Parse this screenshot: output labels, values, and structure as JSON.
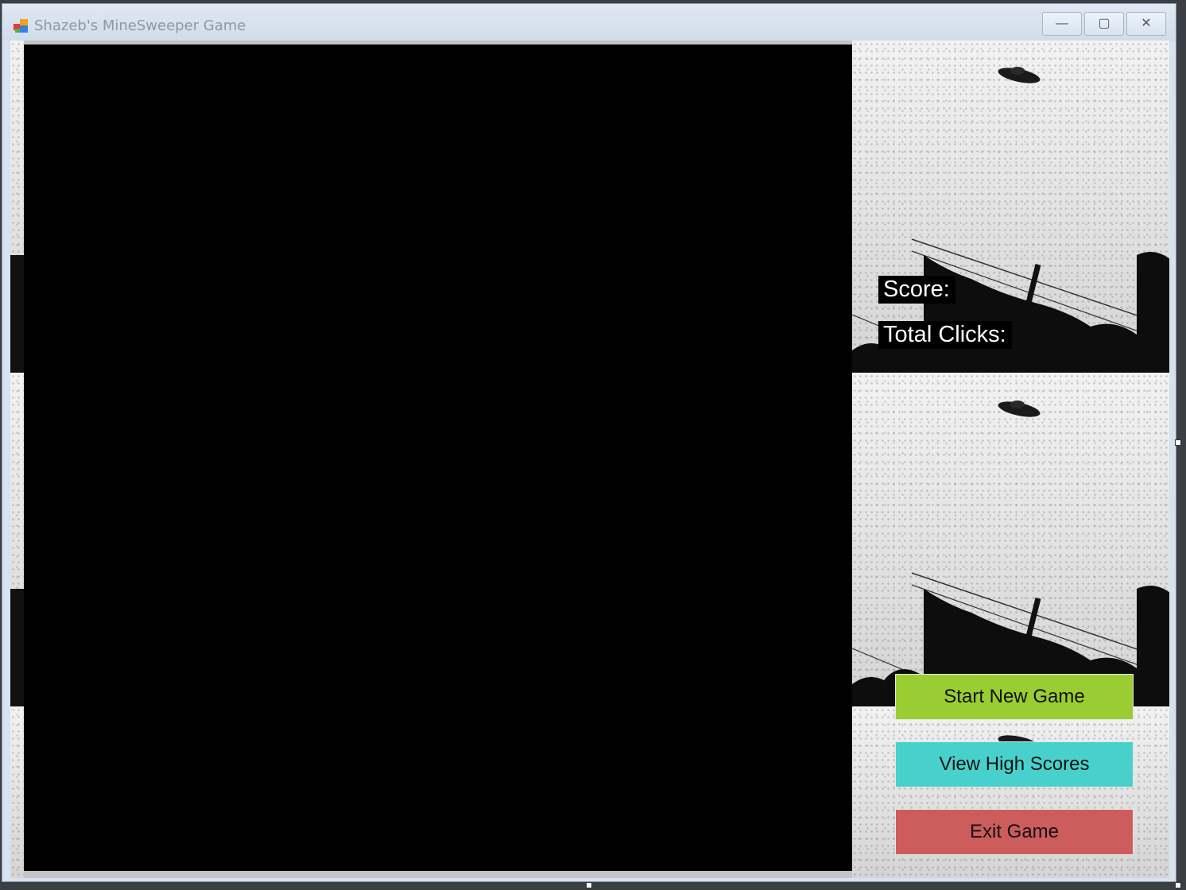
{
  "window": {
    "title": "Shazeb's MineSweeper Game",
    "controls": {
      "minimize": "—",
      "maximize": "▢",
      "close": "✕"
    }
  },
  "stats": {
    "score_label": "Score:",
    "clicks_label": "Total Clicks:"
  },
  "buttons": {
    "start_label": "Start New Game",
    "start_color": "#9acd32",
    "scores_label": "View High Scores",
    "scores_color": "#48d1cc",
    "exit_label": "Exit Game",
    "exit_color": "#cd5c5c"
  },
  "background_image": "ufo-photo-icon"
}
